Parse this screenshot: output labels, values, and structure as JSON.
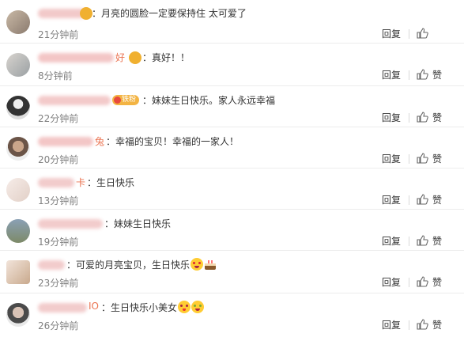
{
  "reply_label": "回复",
  "like_label": "赞",
  "comments": [
    {
      "name_tail": "",
      "badge": "",
      "text": "：月亮的圆脸一定要保持住  太可爱了",
      "time": "21分钟前",
      "like_text": ""
    },
    {
      "name_tail": "好",
      "badge": "",
      "text": "：真好！！",
      "time": "8分钟前",
      "like_text": "赞"
    },
    {
      "name_tail": "",
      "badge": "铁粉",
      "text": "：妹妹生日快乐。家人永远幸福",
      "time": "22分钟前",
      "like_text": "赞"
    },
    {
      "name_tail": "兔",
      "badge": "",
      "text": "：幸福的宝贝！幸福的一家人！",
      "time": "20分钟前",
      "like_text": "赞"
    },
    {
      "name_tail": "卡",
      "badge": "",
      "text": "：生日快乐",
      "time": "13分钟前",
      "like_text": "赞"
    },
    {
      "name_tail": "",
      "badge": "",
      "text": "：妹妹生日快乐",
      "time": "19分钟前",
      "like_text": "赞"
    },
    {
      "name_tail": "",
      "badge": "",
      "text": "：可爱的月亮宝贝，生日快乐",
      "time": "23分钟前",
      "like_text": "赞"
    },
    {
      "name_tail": "IO",
      "badge": "",
      "text": "：生日快乐小美女",
      "time": "26分钟前",
      "like_text": "赞"
    }
  ],
  "colors": {
    "name": "#eb7350",
    "time": "#808080",
    "badge": "#f3b443",
    "separator": "#ececec"
  },
  "icons": [
    "avatar",
    "vip-crown-icon",
    "fan-badge-icon",
    "smile-emoji-icon",
    "cake-emoji-icon",
    "thumb-up-icon"
  ]
}
